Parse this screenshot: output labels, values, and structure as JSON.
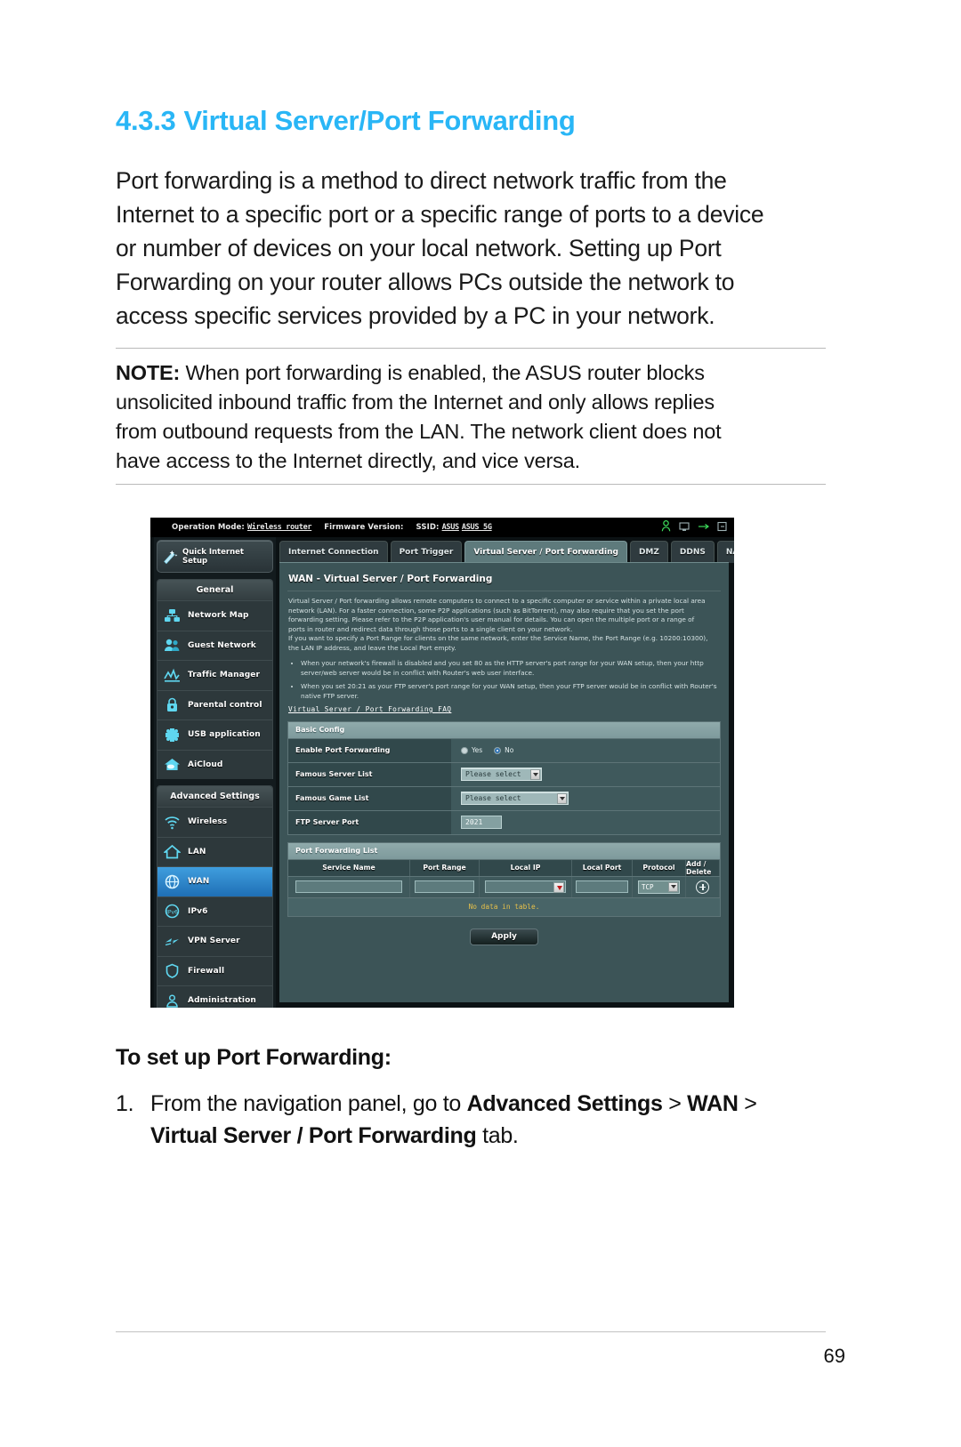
{
  "section": {
    "number": "4.3.3",
    "title": "Virtual Server/Port Forwarding",
    "paragraph_lines": [
      "Port forwarding is a method to direct network traffic from the",
      "Internet to a specific port or a specific range of ports to a device",
      "or number of devices on your local network. Setting up Port",
      "Forwarding on your router allows PCs outside the network to",
      "access specific services provided by a PC in your network."
    ]
  },
  "note": {
    "label": "NOTE:",
    "lines": [
      " When port forwarding is enabled, the ASUS router blocks",
      "unsolicited inbound traffic from the Internet and only allows replies",
      "from outbound requests from the LAN. The network client does not",
      "have access to the Internet directly, and vice versa."
    ]
  },
  "router_ui": {
    "topbar": {
      "operation_mode_label": "Operation Mode:",
      "operation_mode_value": "Wireless router",
      "firmware_label": "Firmware Version:",
      "ssid_label": "SSID:",
      "ssid_value_1": "ASUS",
      "ssid_value_2": "ASUS_5G"
    },
    "quick_setup": {
      "line1": "Quick Internet",
      "line2": "Setup"
    },
    "nav_general_header": "General",
    "nav_general_items": [
      {
        "label": "Network Map",
        "icon": "network-map-icon"
      },
      {
        "label": "Guest Network",
        "icon": "guest-network-icon"
      },
      {
        "label": "Traffic Manager",
        "icon": "traffic-manager-icon"
      },
      {
        "label": "Parental control",
        "icon": "parental-control-icon"
      },
      {
        "label": "USB application",
        "icon": "usb-application-icon"
      },
      {
        "label": "AiCloud",
        "icon": "aicloud-icon"
      }
    ],
    "nav_advanced_header": "Advanced Settings",
    "nav_advanced_items": [
      {
        "label": "Wireless",
        "icon": "wireless-icon"
      },
      {
        "label": "LAN",
        "icon": "lan-icon"
      },
      {
        "label": "WAN",
        "icon": "wan-icon"
      },
      {
        "label": "IPv6",
        "icon": "ipv6-icon"
      },
      {
        "label": "VPN Server",
        "icon": "vpn-server-icon"
      },
      {
        "label": "Firewall",
        "icon": "firewall-icon"
      },
      {
        "label": "Administration",
        "icon": "administration-icon"
      }
    ],
    "tabs": [
      "Internet Connection",
      "Port Trigger",
      "Virtual Server / Port Forwarding",
      "DMZ",
      "DDNS",
      "NAT Passthrough"
    ],
    "active_tab": "Virtual Server / Port Forwarding",
    "panel_title": "WAN - Virtual Server / Port Forwarding",
    "description_lines": [
      "Virtual Server / Port forwarding allows remote computers to connect to a specific computer or service within a private local area",
      "network (LAN). For a faster connection, some P2P applications (such as BitTorrent), may also require that you set the port",
      "forwarding setting. Please refer to the P2P application's user manual for details. You can open the multiple port or a range of",
      "ports in router and redirect data through those ports to a single client on your network.",
      "If you want to specify a Port Range for clients on the same network, enter the Service Name, the Port Range (e.g. 10200:10300),",
      "the LAN IP address, and leave the Local Port empty."
    ],
    "bullets": [
      "When your network's firewall is disabled and you set 80 as the HTTP server's port range for your WAN setup, then your http server/web server would be in conflict with Router's web user interface.",
      "When you set 20:21 as your FTP server's port range for your WAN setup, then your FTP server would be in conflict with Router's native FTP server."
    ],
    "faq_link": "Virtual Server / Port Forwarding FAQ",
    "basic_config": {
      "header": "Basic Config",
      "rows": [
        {
          "label": "Enable Port Forwarding",
          "type": "radio",
          "options": [
            "Yes",
            "No"
          ],
          "selected": "No"
        },
        {
          "label": "Famous Server List",
          "type": "select",
          "value": "Please select"
        },
        {
          "label": "Famous Game List",
          "type": "select",
          "value": "Please select"
        },
        {
          "label": "FTP Server Port",
          "type": "text",
          "value": "2021"
        }
      ]
    },
    "port_forwarding_list": {
      "header": "Port Forwarding List",
      "columns": [
        "Service Name",
        "Port Range",
        "Local IP",
        "Local Port",
        "Protocol",
        "Add / Delete"
      ],
      "row_values": {
        "service_name": "",
        "port_range": "",
        "local_ip": "",
        "local_port": "",
        "protocol": "TCP"
      },
      "empty_message": "No data in table."
    },
    "apply_button": "Apply"
  },
  "instructions": {
    "heading": "To set up Port Forwarding:",
    "step_number": "1.",
    "step_lines": [
      "From the navigation panel, go to Advanced Settings > WAN >",
      "Virtual Server / Port Forwarding tab."
    ]
  },
  "page_number": "69",
  "colors": {
    "heading_blue": "#29b6f6",
    "ui_panel": "#3c5457",
    "ui_accent": "#2f8ad0",
    "warning_yellow": "#e8c14a"
  }
}
